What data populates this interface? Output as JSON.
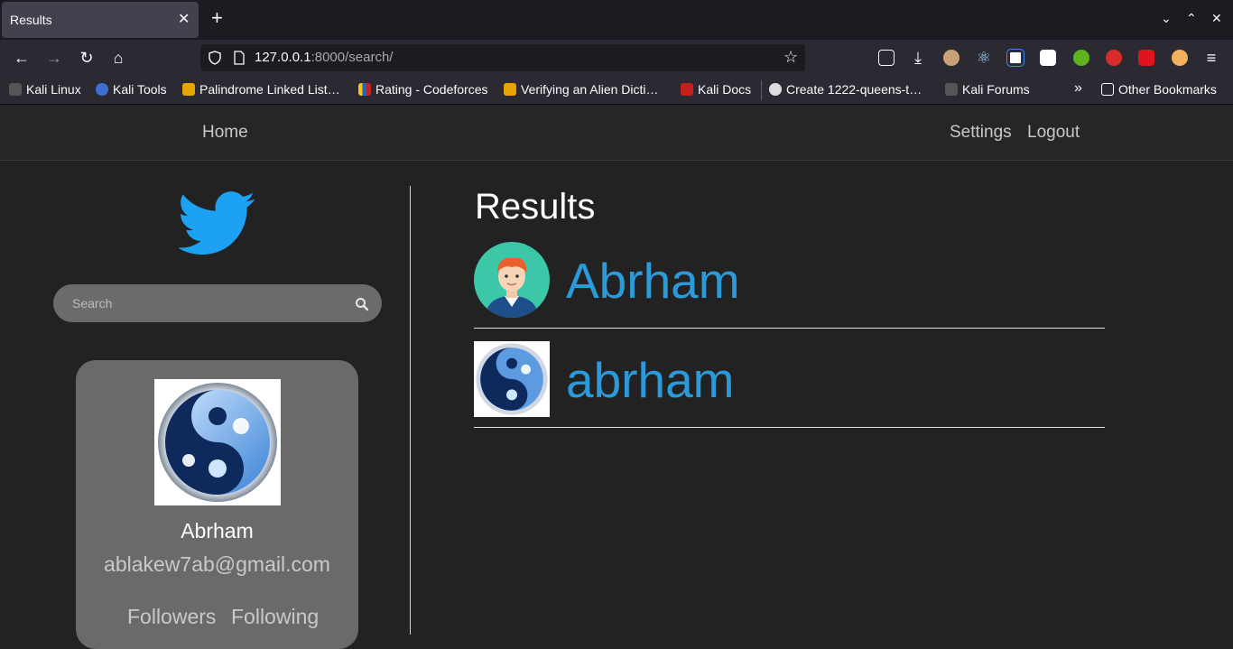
{
  "browser": {
    "tab_title": "Results",
    "url_host": "127.0.0.1",
    "url_rest": ":8000/search/",
    "bookmarks": [
      {
        "label": "Kali Linux",
        "color": "#3a3a3a"
      },
      {
        "label": "Kali Tools",
        "color": "#3b6fd1"
      },
      {
        "label": "Palindrome Linked List…",
        "color": "#e8a400"
      },
      {
        "label": "Rating - Codeforces",
        "color": "#1f62c8"
      },
      {
        "label": "Verifying an Alien Dicti…",
        "color": "#e8a400"
      },
      {
        "label": "Kali Docs",
        "color": "#c4201f"
      },
      {
        "label": "Create 1222-queens-t…",
        "color": "#dddddd"
      },
      {
        "label": "Kali Forums",
        "color": "#3a3a3a"
      }
    ],
    "other_bookmarks": "Other Bookmarks"
  },
  "site_nav": {
    "home": "Home",
    "settings": "Settings",
    "logout": "Logout"
  },
  "sidebar": {
    "search_placeholder": "Search",
    "profile": {
      "name": "Abrham",
      "email": "ablakew7ab@gmail.com",
      "followers_label": "Followers",
      "following_label": "Following"
    }
  },
  "main": {
    "title": "Results",
    "results": [
      {
        "name": "Abrham",
        "avatar": "cartoon-avatar"
      },
      {
        "name": "abrham",
        "avatar": "yin-yang-sky-avatar"
      }
    ]
  },
  "colors": {
    "accent_blue": "#2c9ad8",
    "twitter_blue": "#1da1f2"
  }
}
